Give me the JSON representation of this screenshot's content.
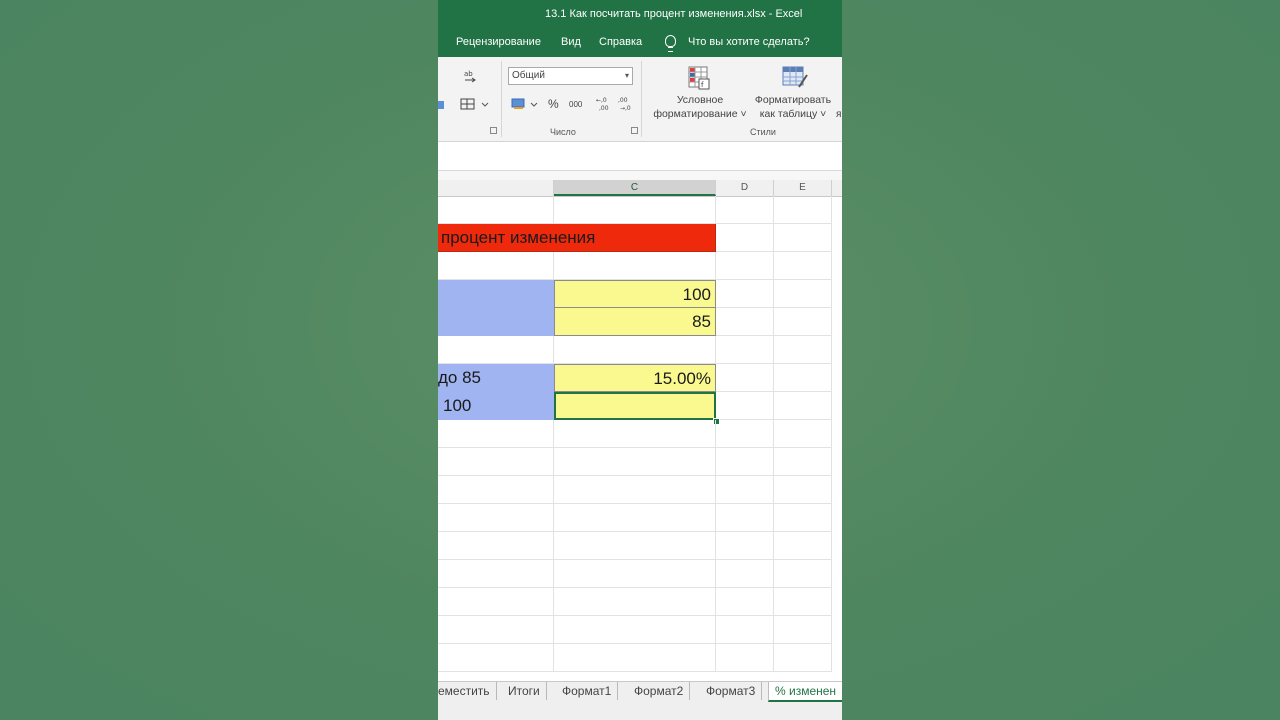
{
  "window": {
    "title": "13.1 Как посчитать процент изменения.xlsx  -  Excel"
  },
  "ribbon_tabs": [
    {
      "label": "Рецензирование"
    },
    {
      "label": "Вид"
    },
    {
      "label": "Справка"
    }
  ],
  "tell_me": {
    "placeholder": "Что вы хотите сделать?"
  },
  "ribbon": {
    "number_format": {
      "value": "Общий"
    },
    "percent_symbol": "%",
    "thousands_symbol": "000",
    "increase_decimal": "←,0 ,00",
    "decrease_decimal": ",00 →,0",
    "group_number": "Число",
    "group_styles": "Стили",
    "conditional_formatting": {
      "line1": "Условное",
      "line2": "форматирование ˅"
    },
    "format_as_table": {
      "line1": "Форматировать",
      "line2": "как таблицу ˅"
    },
    "next_item": "я"
  },
  "columns": [
    {
      "label": "C"
    },
    {
      "label": "D"
    },
    {
      "label": "E"
    }
  ],
  "cells": {
    "title": "процент изменения",
    "c_row1": "100",
    "c_row2": "85",
    "b_row3": "до 85",
    "c_row3": "15.00%",
    "b_row4": "100",
    "c_row4": ""
  },
  "sheet_tabs": [
    {
      "label": "еместить"
    },
    {
      "label": "Итоги"
    },
    {
      "label": "Формат1"
    },
    {
      "label": "Формат2"
    },
    {
      "label": "Формат3"
    },
    {
      "label": "% изменен",
      "active": true
    }
  ],
  "colors": {
    "excel_green": "#217346",
    "title_fill": "#ef2a0c",
    "label_fill": "#9fb4f0",
    "value_fill": "#faf990",
    "backdrop": "#4e8660"
  }
}
